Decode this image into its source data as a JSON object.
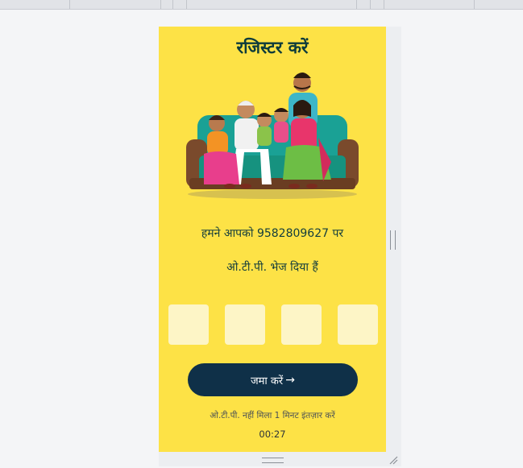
{
  "register": {
    "title": "रजिस्टर करें",
    "otp_sent_line1": "हमने आपको 9582809627 पर",
    "otp_sent_line2": "ओ.टी.पी. भेज दिया हैं",
    "otp_digits": [
      "",
      "",
      "",
      ""
    ],
    "submit_label": "जमा करें",
    "submit_icon": "arrow-right-icon",
    "resend_text": "ओ.टी.पी. नहीं मिला 1 मिनट इंतज़ार करें",
    "timer": "00:27"
  },
  "colors": {
    "background": "#fde246",
    "otp_box": "#fdf5c6",
    "button": "#0f3048",
    "title": "#0d3b3b"
  }
}
